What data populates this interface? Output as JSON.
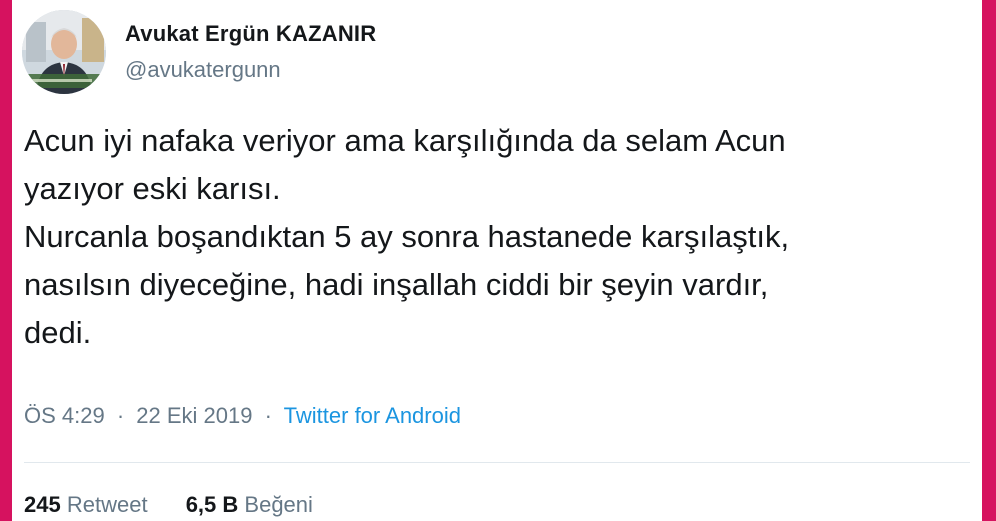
{
  "author": {
    "name": "Avukat Ergün KAZANIR",
    "handle": "@avukatergunn",
    "avatar_icon": "profile-photo"
  },
  "tweet": {
    "lines": [
      "Acun iyi nafaka veriyor ama karşılığında da selam Acun",
      "yazıyor eski karısı.",
      "Nurcanla boşandıktan 5 ay sonra hastanede karşılaştık,",
      "nasılsın diyeceğine, hadi inşallah ciddi bir şeyin vardır,",
      "dedi."
    ]
  },
  "meta": {
    "time": "ÖS 4:29",
    "separator": "·",
    "date": "22 Eki 2019",
    "source": "Twitter for Android"
  },
  "stats": {
    "retweets": {
      "count": "245",
      "label": "Retweet"
    },
    "likes": {
      "count": "6,5 B",
      "label": "Beğeni"
    }
  },
  "colors": {
    "border": "#d6125f",
    "text": "#14171a",
    "secondary": "#657786",
    "link": "#1b95e0"
  }
}
